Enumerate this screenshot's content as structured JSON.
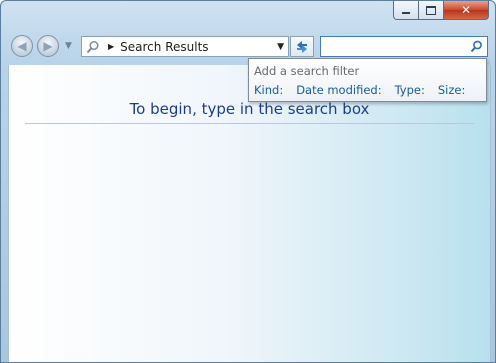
{
  "address_bar": {
    "location": "Search Results"
  },
  "search_box": {
    "value": "",
    "placeholder": ""
  },
  "filter_popup": {
    "title": "Add a search filter",
    "filters": [
      "Kind:",
      "Date modified:",
      "Type:",
      "Size:"
    ]
  },
  "content": {
    "message": "To begin, type in the search box"
  },
  "colors": {
    "filter_link": "#1a5c99",
    "message_text": "#1e3e8c",
    "close_button": "#c74a2f"
  }
}
